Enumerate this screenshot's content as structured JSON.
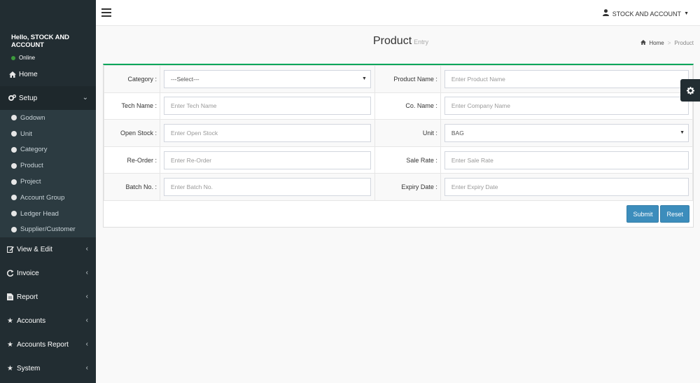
{
  "sidebar": {
    "user": {
      "greeting": "Hello, STOCK AND ACCOUNT",
      "status": "Online"
    },
    "home": {
      "label": "Home",
      "icon": "home-icon"
    },
    "setup": {
      "label": "Setup",
      "icon": "cogs-icon",
      "items": [
        "Godown",
        "Unit",
        "Category",
        "Product",
        "Project",
        "Account Group",
        "Ledger Head",
        "Supplier/Customer"
      ]
    },
    "menu": [
      {
        "label": "View & Edit",
        "icon": "edit-icon"
      },
      {
        "label": "Invoice",
        "icon": "refresh-icon"
      },
      {
        "label": "Report",
        "icon": "file-icon"
      },
      {
        "label": "Accounts",
        "icon": "star-icon"
      },
      {
        "label": "Accounts Report",
        "icon": "star-icon"
      },
      {
        "label": "System",
        "icon": "star-icon"
      }
    ]
  },
  "header": {
    "user_label": "STOCK AND ACCOUNT"
  },
  "page": {
    "title": "Product",
    "subtitle": "Entry"
  },
  "breadcrumb": {
    "home": "Home",
    "current": "Product"
  },
  "form": {
    "category": {
      "label": "Category :",
      "value": "---Select---"
    },
    "product_name": {
      "label": "Product Name :",
      "placeholder": "Enter Product Name"
    },
    "tech_name": {
      "label": "Tech Name :",
      "placeholder": "Enter Tech Name"
    },
    "co_name": {
      "label": "Co. Name :",
      "placeholder": "Enter Company Name"
    },
    "open_stock": {
      "label": "Open Stock :",
      "placeholder": "Enter Open Stock"
    },
    "unit": {
      "label": "Unit :",
      "value": "BAG"
    },
    "re_order": {
      "label": "Re-Order :",
      "placeholder": "Enter Re-Order"
    },
    "sale_rate": {
      "label": "Sale Rate :",
      "placeholder": "Enter Sale Rate"
    },
    "batch_no": {
      "label": "Batch No. :",
      "placeholder": "Enter Batch No."
    },
    "expiry_date": {
      "label": "Expiry Date :",
      "placeholder": "Enter Expiry Date"
    },
    "submit_label": "Submit",
    "reset_label": "Reset"
  },
  "colors": {
    "sidebar_bg": "#222d32",
    "accent": "#3c8dbc",
    "box_border": "#00a65a"
  }
}
